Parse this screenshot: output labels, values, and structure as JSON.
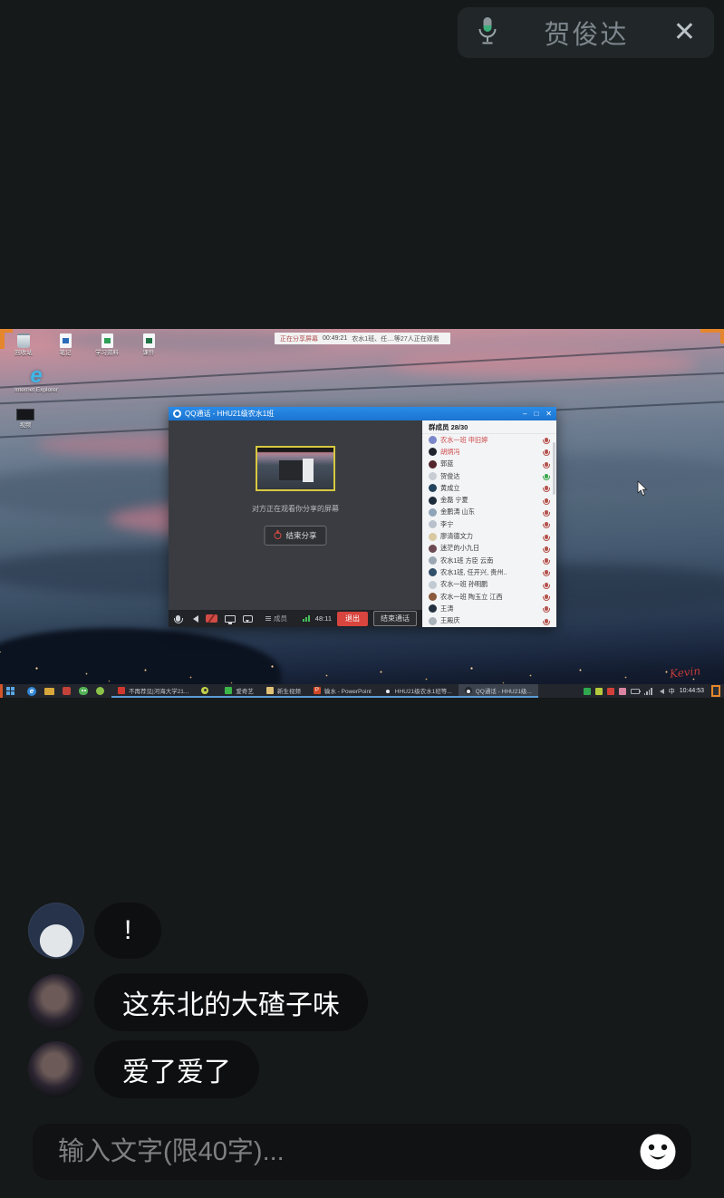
{
  "header": {
    "speaker_name": "贺俊达",
    "close_icon": "✕"
  },
  "screen_share": {
    "banner": {
      "status": "正在分享屏幕",
      "timer": "00:49:21",
      "viewers": "农水1班、任....等27人正在观看"
    },
    "desktop_icons": [
      {
        "label": "回收站"
      },
      {
        "label": "笔记"
      },
      {
        "label": "学习资料"
      },
      {
        "label": "课件"
      },
      {
        "label": "Internet Explorer"
      },
      {
        "label": "视频"
      }
    ],
    "wallpaper_signature": "Kevin",
    "qq_window": {
      "title": "QQ通话 - HHU21级农水1班",
      "controls": {
        "minimize": "–",
        "maximize": "□",
        "close": "✕"
      },
      "preview_caption": "对方正在观看你分享的屏幕",
      "end_share_button": "结束分享",
      "toolbar": {
        "members_label": "成员",
        "timer": "48:11",
        "exit_button": "退出",
        "end_call_button": "结束通话"
      },
      "member_panel": {
        "header": "群成员 28/30",
        "members": [
          {
            "name": "农水一班 申旧婷"
          },
          {
            "name": "胡炳冯"
          },
          {
            "name": "郭蓝"
          },
          {
            "name": "贺俊达"
          },
          {
            "name": "黄成立"
          },
          {
            "name": "金磊 宁夏"
          },
          {
            "name": "金鹏涛 山东"
          },
          {
            "name": "李宁"
          },
          {
            "name": "廖清德文力"
          },
          {
            "name": "迷茫的小九日"
          },
          {
            "name": "农水1班 方臣 云南"
          },
          {
            "name": "农水1班, 任开兴, 贵州.."
          },
          {
            "name": "农水一班 孙明鹏"
          },
          {
            "name": "农水一班 陶玉立 江西"
          },
          {
            "name": "王涛"
          },
          {
            "name": "王殿庆"
          }
        ]
      }
    },
    "taskbar": {
      "tasks": [
        {
          "label": "不再荐见|河海大学21..."
        },
        {
          "label": ""
        },
        {
          "label": "爱奇艺"
        },
        {
          "label": "新生视频"
        },
        {
          "label": "输水 - PowerPoint"
        },
        {
          "label": "HHU21级农水1班等..."
        },
        {
          "label": "QQ通话 - HHU21级..."
        }
      ],
      "input_method": "中",
      "clock": "10:44:53"
    }
  },
  "chat": {
    "messages": [
      {
        "text": "!"
      },
      {
        "text": "这东北的大碴子味"
      },
      {
        "text": "爱了爱了"
      }
    ]
  },
  "composer": {
    "placeholder": "输入文字(限40字)..."
  }
}
